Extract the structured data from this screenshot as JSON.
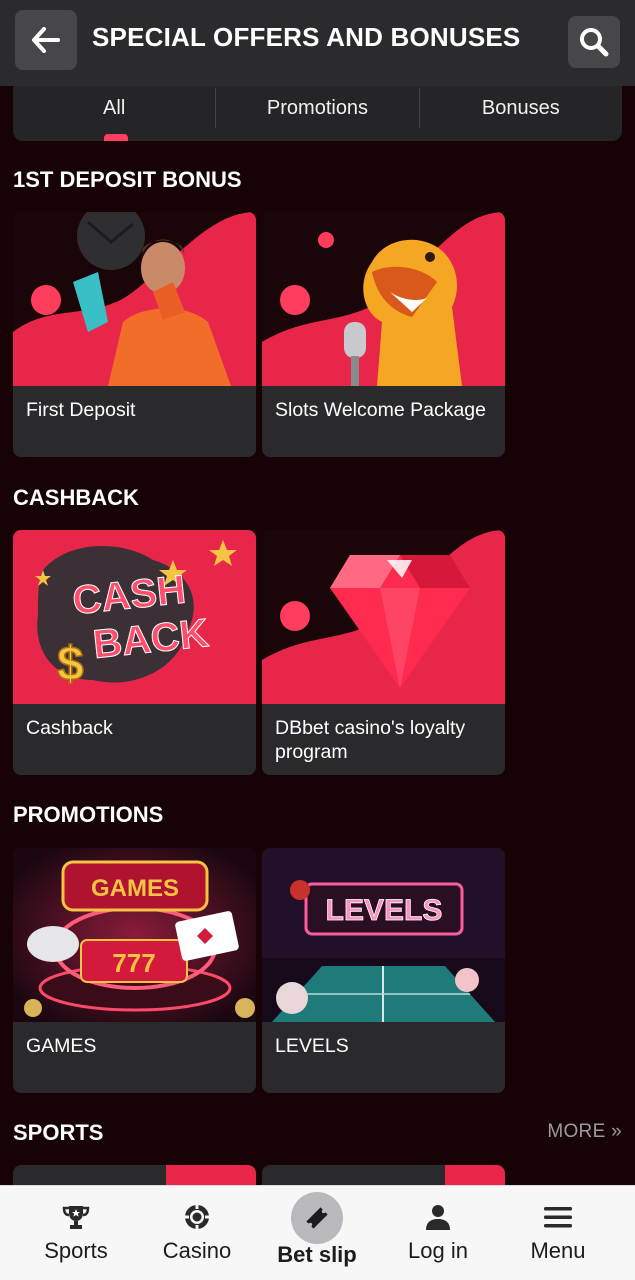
{
  "header": {
    "title": "SPECIAL OFFERS AND BONUSES",
    "back_icon": "arrow-left-icon",
    "search_icon": "search-icon"
  },
  "tabs": [
    {
      "label": "All",
      "active": true
    },
    {
      "label": "Promotions",
      "active": false
    },
    {
      "label": "Bonuses",
      "active": false
    }
  ],
  "sections": [
    {
      "title": "1ST DEPOSIT BONUS",
      "cards": [
        {
          "label": "First Deposit"
        },
        {
          "label": "Slots Welcome Package"
        }
      ]
    },
    {
      "title": "CASHBACK",
      "cards": [
        {
          "label": "Cashback",
          "image_text_1": "CASH",
          "image_text_2": "BACK"
        },
        {
          "label": "DBbet casino's loyalty program"
        }
      ]
    },
    {
      "title": "PROMOTIONS",
      "cards": [
        {
          "label": "GAMES",
          "image_text": "GAMES",
          "image_reels": "777"
        },
        {
          "label": "LEVELS",
          "image_text": "LEVELS"
        }
      ]
    },
    {
      "title": "SPORTS",
      "more": "MORE »"
    }
  ],
  "bottom_nav": [
    {
      "label": "Sports",
      "icon": "trophy-icon"
    },
    {
      "label": "Casino",
      "icon": "casino-chip-icon"
    },
    {
      "label": "Bet slip",
      "icon": "ticket-icon"
    },
    {
      "label": "Log in",
      "icon": "user-icon"
    },
    {
      "label": "Menu",
      "icon": "hamburger-menu-icon"
    }
  ],
  "colors": {
    "background": "#170306",
    "accent": "#ff3f62",
    "card": "#2a2a2c",
    "header": "#2b2b2d"
  }
}
